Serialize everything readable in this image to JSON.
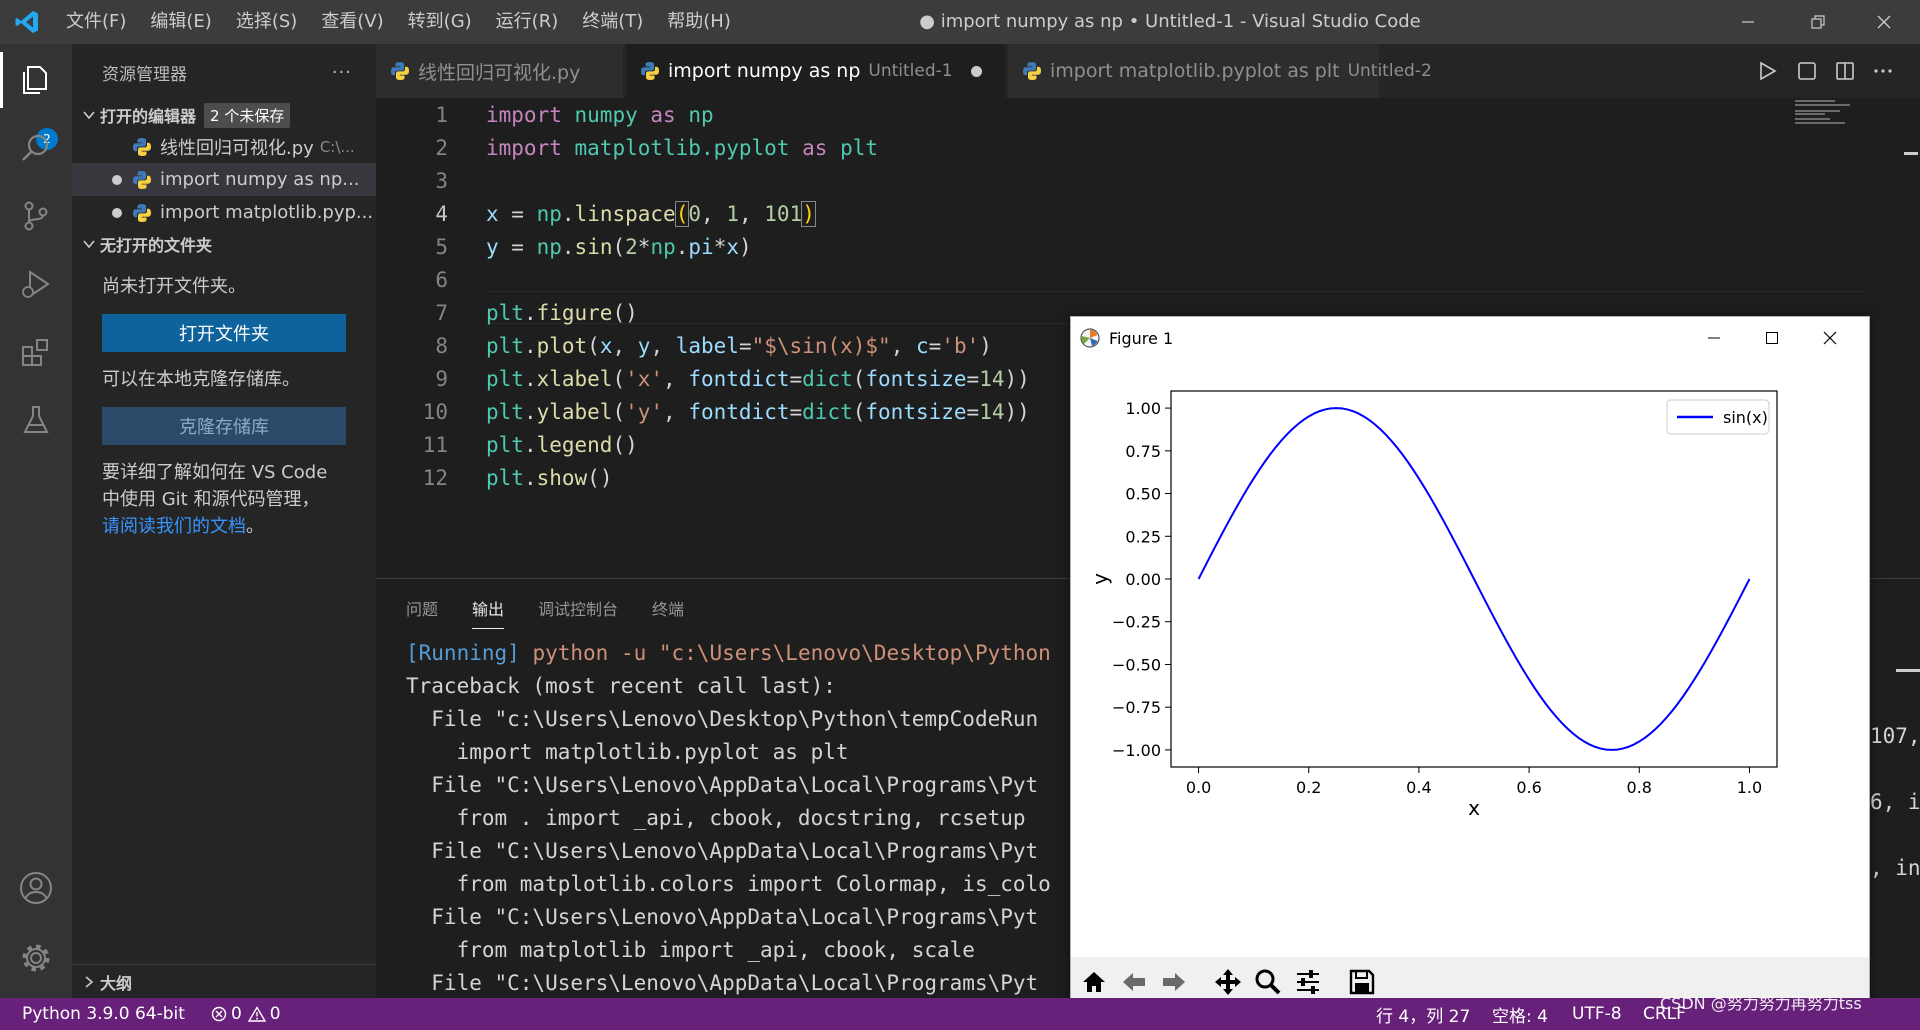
{
  "window": {
    "title": "● import numpy as np • Untitled-1 - Visual Studio Code"
  },
  "menu": [
    "文件(F)",
    "编辑(E)",
    "选择(S)",
    "查看(V)",
    "转到(G)",
    "运行(R)",
    "终端(T)",
    "帮助(H)"
  ],
  "activity": {
    "badge": "2"
  },
  "sidebar": {
    "title": "资源管理器",
    "more": "···",
    "open_editors": {
      "label": "打开的编辑器",
      "badge": "2 个未保存",
      "items": [
        {
          "name": "线性回归可视化.py",
          "path": "C:\\...",
          "dirty": false
        },
        {
          "name": "import numpy as np...",
          "path": "",
          "dirty": true
        },
        {
          "name": "import matplotlib.pyp...",
          "path": "",
          "dirty": true
        }
      ]
    },
    "no_folder": {
      "label": "无打开的文件夹",
      "msg1": "尚未打开文件夹。",
      "open_btn": "打开文件夹",
      "msg2": "可以在本地克隆存储库。",
      "clone_btn": "克隆存储库",
      "msg3a": "要详细了解如何在 VS Code",
      "msg3b": "中使用 Git 和源代码管理，",
      "link": "请阅读我们的文档",
      "link_after": "。"
    },
    "outline": "大纲"
  },
  "tabs": [
    {
      "name": "线性回归可视化.py",
      "desc": "",
      "dirty": false
    },
    {
      "name": "import numpy as np",
      "desc": "Untitled-1",
      "dirty": true
    },
    {
      "name": "import matplotlib.pyplot as plt",
      "desc": "Untitled-2",
      "dirty": true
    }
  ],
  "code": {
    "current_line": 4,
    "lines": [
      "1",
      "2",
      "3",
      "4",
      "5",
      "6",
      "7",
      "8",
      "9",
      "10",
      "11",
      "12"
    ]
  },
  "panel": {
    "tabs": [
      "问题",
      "输出",
      "调试控制台",
      "终端"
    ],
    "active_tab": "输出",
    "output": {
      "l1a": "[Running]",
      "l1b": " python -u \"c:\\Users\\Lenovo\\Desktop\\Python",
      "l2": "Traceback (most recent call last):",
      "l3": "  File \"c:\\Users\\Lenovo\\Desktop\\Python\\tempCodeRun",
      "l4": "    import matplotlib.pyplot as plt",
      "l5": "  File \"C:\\Users\\Lenovo\\AppData\\Local\\Programs\\Pyt",
      "l6": "    from . import _api, cbook, docstring, rcsetup",
      "l7": "  File \"C:\\Users\\Lenovo\\AppData\\Local\\Programs\\Pyt",
      "l8": "    from matplotlib.colors import Colormap, is_colo",
      "l9": "  File \"C:\\Users\\Lenovo\\AppData\\Local\\Programs\\Pyt",
      "l10": "    from matplotlib import _api, cbook, scale",
      "l11": "  File \"C:\\Users\\Lenovo\\AppData\\Local\\Programs\\Pyt",
      "r1": "107,",
      "r2": "6, i",
      "r3": ", in"
    }
  },
  "figure": {
    "title": "Figure 1",
    "chart_data": {
      "type": "line",
      "x_start": 0.0,
      "x_end": 1.0,
      "num_points": 101,
      "function": "sin(2*pi*x)",
      "series": [
        {
          "name": "sin(x)",
          "color": "#0000ff"
        }
      ],
      "xlabel": "x",
      "ylabel": "y",
      "xlim": [
        -0.05,
        1.05
      ],
      "ylim": [
        -1.1,
        1.1
      ],
      "xticks": [
        "0.0",
        "0.2",
        "0.4",
        "0.6",
        "0.8",
        "1.0"
      ],
      "xtick_values": [
        0.0,
        0.2,
        0.4,
        0.6,
        0.8,
        1.0
      ],
      "yticks": [
        "1.00",
        "0.75",
        "0.50",
        "0.25",
        "0.00",
        "−0.25",
        "−0.50",
        "−0.75",
        "−1.00"
      ],
      "ytick_values": [
        1.0,
        0.75,
        0.5,
        0.25,
        0.0,
        -0.25,
        -0.5,
        -0.75,
        -1.0
      ],
      "legend": "top-right",
      "grid": false
    }
  },
  "status": {
    "python": "Python 3.9.0 64-bit",
    "errors": "0",
    "warnings": "0",
    "position": "行 4，列 27",
    "spaces": "空格: 4",
    "encoding": "UTF-8",
    "eol": "CRLF"
  },
  "watermark": "CSDN @努力努力再努力tss",
  "colors": {
    "accent": "#007acc",
    "statusbar": "#68217a",
    "button": "#0e639c"
  }
}
